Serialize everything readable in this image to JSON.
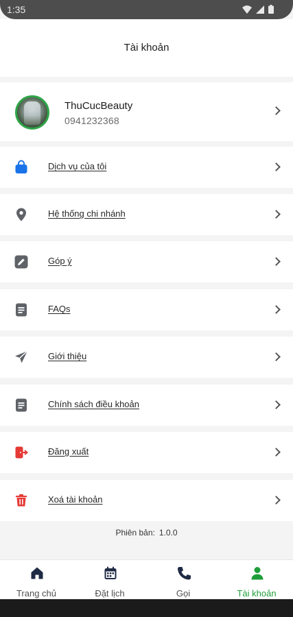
{
  "status_bar": {
    "time": "1:35"
  },
  "header": {
    "title": "Tài khoản"
  },
  "profile": {
    "name": "ThuCucBeauty",
    "phone": "0941232368"
  },
  "menu": [
    {
      "label": "Dịch vụ của tôi",
      "icon": "shopping-bag-icon",
      "color": "#1a73e8"
    },
    {
      "label": "Hệ thống chi nhánh",
      "icon": "location-pin-icon",
      "color": "#5f6368"
    },
    {
      "label": "Góp ý",
      "icon": "edit-icon",
      "color": "#5f6368"
    },
    {
      "label": "FAQs",
      "icon": "document-icon",
      "color": "#5f6368"
    },
    {
      "label": "Giới thiệu",
      "icon": "send-icon",
      "color": "#5f6368"
    },
    {
      "label": "Chính sách điều khoản",
      "icon": "document-icon",
      "color": "#5f6368"
    },
    {
      "label": "Đăng xuất",
      "icon": "logout-icon",
      "color": "#e53935"
    },
    {
      "label": "Xoá tài khoản",
      "icon": "trash-icon",
      "color": "#e53935"
    }
  ],
  "version": {
    "label": "Phiên bản:",
    "value": "1.0.0"
  },
  "bottom_nav": [
    {
      "label": "Trang chủ",
      "icon": "home-icon",
      "active": false
    },
    {
      "label": "Đặt lịch",
      "icon": "calendar-icon",
      "active": false
    },
    {
      "label": "Gọi",
      "icon": "phone-icon",
      "active": false
    },
    {
      "label": "Tài khoản",
      "icon": "person-icon",
      "active": true
    }
  ],
  "colors": {
    "accent": "#1e9e3a",
    "dark_icon": "#1f2a44",
    "danger": "#e53935",
    "info": "#1a73e8"
  }
}
